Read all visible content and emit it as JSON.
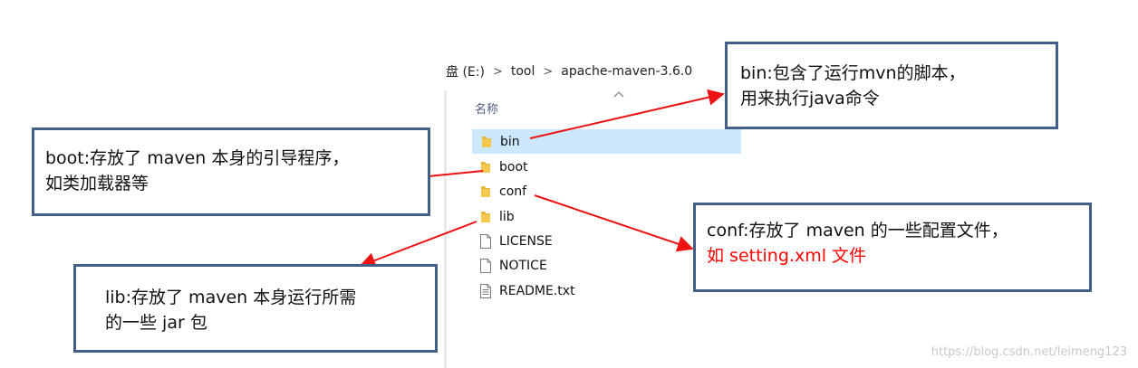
{
  "breadcrumb": {
    "parts": [
      "盘 (E:)",
      "tool",
      "apache-maven-3.6.0"
    ],
    "separator": ">"
  },
  "file_list": {
    "column_header": "名称",
    "sort_icon": "sort-up-chevron-icon",
    "items": [
      {
        "name": "bin",
        "type": "folder",
        "selected": true
      },
      {
        "name": "boot",
        "type": "folder"
      },
      {
        "name": "conf",
        "type": "folder"
      },
      {
        "name": "lib",
        "type": "folder"
      },
      {
        "name": "LICENSE",
        "type": "file"
      },
      {
        "name": "NOTICE",
        "type": "file"
      },
      {
        "name": "README.txt",
        "type": "text-file"
      }
    ]
  },
  "notes": {
    "bin": {
      "line1": "bin:包含了运行mvn的脚本，",
      "line2": "用来执行java命令"
    },
    "boot": {
      "line1": "boot:存放了 maven 本身的引导程序，",
      "line2": "如类加载器等"
    },
    "conf": {
      "line1": "conf:存放了 maven 的一些配置文件，",
      "line2": "如 setting.xml 文件"
    },
    "lib": {
      "line1": "lib:存放了 maven 本身运行所需",
      "line2": "的一些 jar 包"
    }
  },
  "watermark": "https://blog.csdn.net/leimeng123",
  "colors": {
    "box_border": "#435f87",
    "arrow": "#ee1111",
    "selection": "#cce8ff",
    "folder": "#e8b83b",
    "highlight_text": "#ff0000"
  }
}
